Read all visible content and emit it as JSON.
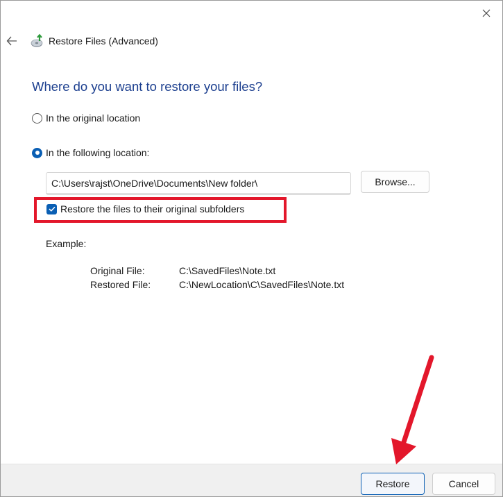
{
  "window": {
    "title": "Restore Files (Advanced)"
  },
  "heading": "Where do you want to restore your files?",
  "options": {
    "original_location": {
      "label": "In the original location",
      "checked": false
    },
    "following_location": {
      "label": "In the following location:",
      "checked": true
    }
  },
  "location": {
    "path": "C:\\Users\\rajst\\OneDrive\\Documents\\New folder\\",
    "browse_label": "Browse..."
  },
  "subfolders": {
    "label": "Restore the files to their original subfolders",
    "checked": true
  },
  "example": {
    "label": "Example:",
    "original_key": "Original File:",
    "original_value": "C:\\SavedFiles\\Note.txt",
    "restored_key": "Restored File:",
    "restored_value": "C:\\NewLocation\\C\\SavedFiles\\Note.txt"
  },
  "footer": {
    "restore_label": "Restore",
    "cancel_label": "Cancel"
  },
  "colors": {
    "accent": "#0a5fb4",
    "heading": "#1c3f8f",
    "annotation": "#e3172b"
  },
  "icons": {
    "back": "arrow-left-icon",
    "close": "close-icon",
    "app": "restore-files-icon"
  }
}
